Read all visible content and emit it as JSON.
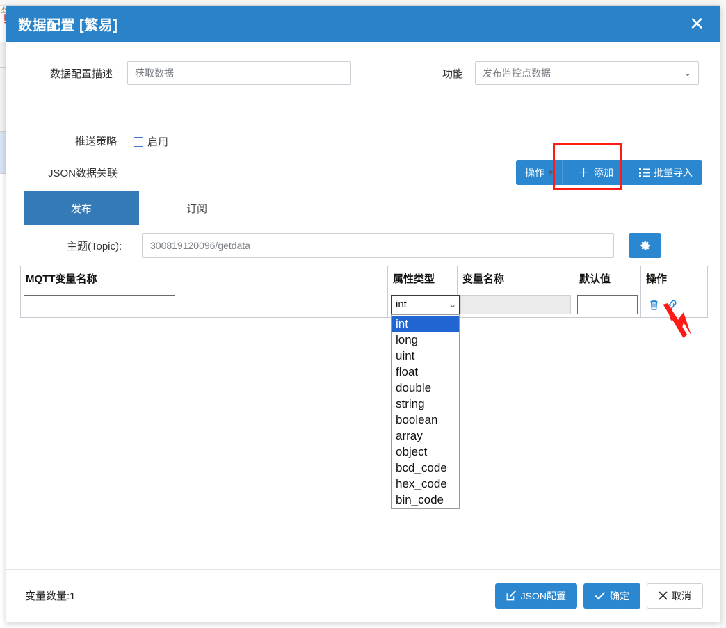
{
  "dialog": {
    "title": "数据配置 [繁易]",
    "close_icon": "close-icon"
  },
  "form": {
    "desc_label": "数据配置描述",
    "desc_value": "获取数据",
    "func_label": "功能",
    "func_value": "发布监控点数据",
    "push_label": "推送策略",
    "push_checkbox_label": "启用",
    "push_checked": false,
    "json_relation_label": "JSON数据关联"
  },
  "toolbar": {
    "op_label": "操作",
    "op_caret": "▾",
    "add_label": "添加",
    "add_icon": "plus-icon",
    "bulk_label": "批量导入",
    "bulk_icon": "list-icon",
    "highlight_color": "#ff1a15"
  },
  "tabs": [
    {
      "label": "发布",
      "active": true
    },
    {
      "label": "订阅",
      "active": false
    }
  ],
  "topic": {
    "label": "主题(Topic):",
    "value": "300819120096/getdata",
    "gear_icon": "gear-icon"
  },
  "table": {
    "headers": [
      "MQTT变量名称",
      "属性类型",
      "变量名称",
      "默认值",
      "操作"
    ],
    "rows": [
      {
        "mqtt_name": "",
        "type": "int",
        "var_name": "",
        "default_value": "",
        "actions": [
          "trash-icon",
          "link-icon"
        ]
      }
    ]
  },
  "type_dropdown": {
    "open": true,
    "selected": "int",
    "options": [
      "int",
      "long",
      "uint",
      "float",
      "double",
      "string",
      "boolean",
      "array",
      "object",
      "bcd_code",
      "hex_code",
      "bin_code"
    ]
  },
  "footer": {
    "var_count_label": "变量数量:1",
    "json_config_label": "JSON配置",
    "json_config_icon": "edit-icon",
    "confirm_label": "确定",
    "confirm_icon": "check-icon",
    "cancel_label": "取消",
    "cancel_icon": "x-icon"
  },
  "colors": {
    "header_blue": "#2a82c8",
    "button_blue": "#2a87d0",
    "tab_blue": "#337ab7",
    "highlight_red": "#ff1a15",
    "option_selected": "#2065d1"
  }
}
